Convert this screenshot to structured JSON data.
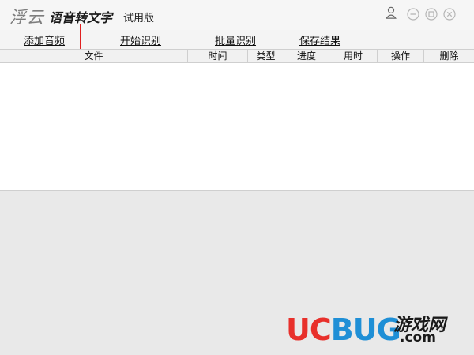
{
  "titlebar": {
    "logo_text": "浮云",
    "app_title": "语音转文字",
    "edition": "试用版",
    "buttons": [
      "user-icon",
      "minimize-icon",
      "restore-icon",
      "close-icon"
    ]
  },
  "toolbar": {
    "add_audio": "添加音频",
    "start_recognize": "开始识别",
    "batch_recognize": "批量识别",
    "save_result": "保存结果",
    "highlight_color": "#e02020"
  },
  "table": {
    "columns": [
      "文件",
      "时间",
      "类型",
      "进度",
      "用时",
      "操作",
      "删除"
    ],
    "rows": []
  },
  "watermark": {
    "brand_u": "UC",
    "brand_bug": "BUG",
    "site": "游戏网",
    "dotcom": ".com",
    "colors": {
      "red": "#e8302b",
      "blue": "#1f8fd6"
    }
  }
}
